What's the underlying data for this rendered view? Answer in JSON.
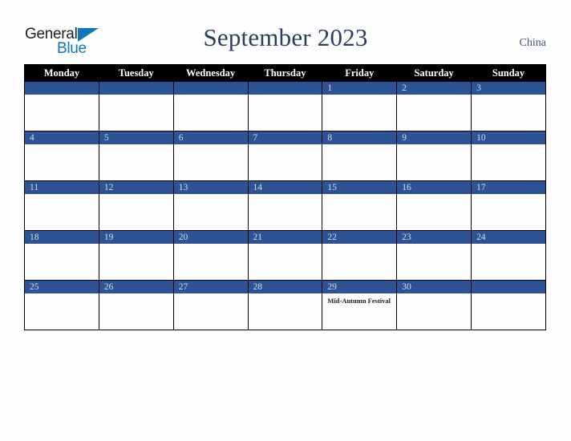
{
  "brand": {
    "name_part1": "General",
    "name_part2": "Blue",
    "wedge_color": "#0f75bc",
    "text_color": "#231f20"
  },
  "header": {
    "title": "September 2023",
    "country": "China",
    "title_color": "#2c3c62"
  },
  "calendar": {
    "weekday_headers": [
      "Monday",
      "Tuesday",
      "Wednesday",
      "Thursday",
      "Friday",
      "Saturday",
      "Sunday"
    ],
    "header_bg": "#000000",
    "header_text_color": "#ffffff",
    "daynum_bg": "#2e5395",
    "daynum_text_color": "#d2dced",
    "cell_bg": "#fdfdfd",
    "grid_line_color": "#000000",
    "weeks": [
      [
        {
          "day": "",
          "events": []
        },
        {
          "day": "",
          "events": []
        },
        {
          "day": "",
          "events": []
        },
        {
          "day": "",
          "events": []
        },
        {
          "day": "1",
          "events": []
        },
        {
          "day": "2",
          "events": []
        },
        {
          "day": "3",
          "events": []
        }
      ],
      [
        {
          "day": "4",
          "events": []
        },
        {
          "day": "5",
          "events": []
        },
        {
          "day": "6",
          "events": []
        },
        {
          "day": "7",
          "events": []
        },
        {
          "day": "8",
          "events": []
        },
        {
          "day": "9",
          "events": []
        },
        {
          "day": "10",
          "events": []
        }
      ],
      [
        {
          "day": "11",
          "events": []
        },
        {
          "day": "12",
          "events": []
        },
        {
          "day": "13",
          "events": []
        },
        {
          "day": "14",
          "events": []
        },
        {
          "day": "15",
          "events": []
        },
        {
          "day": "16",
          "events": []
        },
        {
          "day": "17",
          "events": []
        }
      ],
      [
        {
          "day": "18",
          "events": []
        },
        {
          "day": "19",
          "events": []
        },
        {
          "day": "20",
          "events": []
        },
        {
          "day": "21",
          "events": []
        },
        {
          "day": "22",
          "events": []
        },
        {
          "day": "23",
          "events": []
        },
        {
          "day": "24",
          "events": []
        }
      ],
      [
        {
          "day": "25",
          "events": []
        },
        {
          "day": "26",
          "events": []
        },
        {
          "day": "27",
          "events": []
        },
        {
          "day": "28",
          "events": []
        },
        {
          "day": "29",
          "events": [
            "Mid-Autumn Festival"
          ]
        },
        {
          "day": "30",
          "events": []
        },
        {
          "day": "",
          "events": []
        }
      ]
    ]
  }
}
